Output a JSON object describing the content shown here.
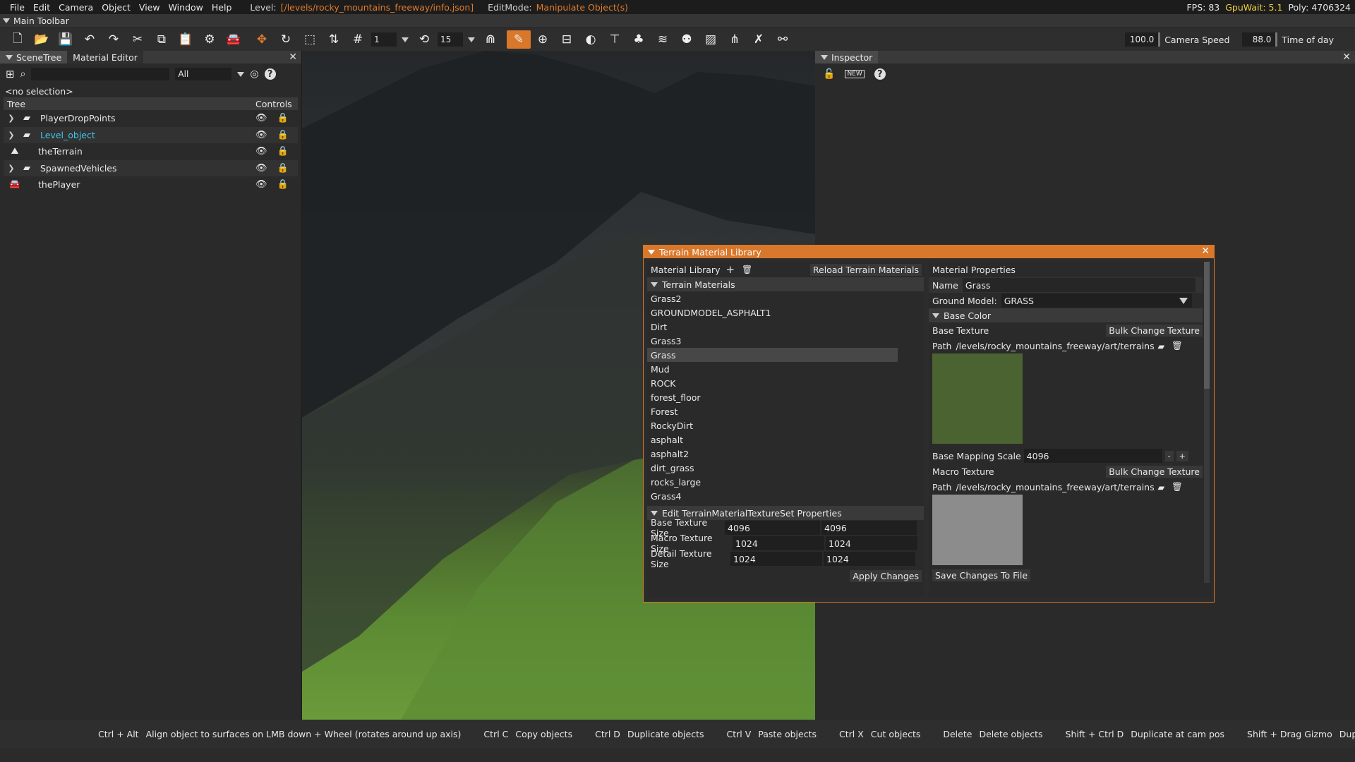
{
  "menu": {
    "items": [
      "File",
      "Edit",
      "Camera",
      "Object",
      "View",
      "Window",
      "Help"
    ],
    "level_label": "Level:",
    "level_path": "[/levels/rocky_mountains_freeway/info.json]",
    "editmode_label": "EditMode:",
    "editmode_value": "Manipulate Object(s)",
    "fps": "FPS: 83",
    "gpuwait": "GpuWait: 5.1",
    "poly": "Poly: 4706324"
  },
  "toolbar": {
    "title": "Main Toolbar",
    "snap_value": "1",
    "rotate_snap": "15",
    "camera_speed_value": "100.0",
    "camera_speed_label": "Camera Speed",
    "time_value": "88.0",
    "time_label": "Time of day"
  },
  "scene": {
    "tabs": [
      "SceneTree",
      "Material Editor"
    ],
    "filter": "All",
    "selection": "<no selection>",
    "col_tree": "Tree",
    "col_controls": "Controls",
    "rows": [
      {
        "name": "PlayerDropPoints",
        "icon": "folder-icon",
        "expandable": true
      },
      {
        "name": "Level_object",
        "icon": "folder-icon",
        "expandable": true,
        "highlight": true
      },
      {
        "name": "theTerrain",
        "icon": "terrain-icon",
        "expandable": false
      },
      {
        "name": "SpawnedVehicles",
        "icon": "folder-icon",
        "expandable": true
      },
      {
        "name": "thePlayer",
        "icon": "vehicle-icon",
        "expandable": false
      }
    ]
  },
  "inspector": {
    "title": "Inspector"
  },
  "tml": {
    "title": "Terrain Material Library",
    "library_label": "Material Library",
    "reload_button": "Reload Terrain Materials",
    "materials_header": "Terrain Materials",
    "materials": [
      "Grass2",
      "GROUNDMODEL_ASPHALT1",
      "Dirt",
      "Grass3",
      "Grass",
      "Mud",
      "ROCK",
      "forest_floor",
      "Forest",
      "RockyDirt",
      "asphalt",
      "asphalt2",
      "dirt_grass",
      "rocks_large",
      "Grass4"
    ],
    "selected_material": "Grass",
    "texset_header": "Edit TerrainMaterialTextureSet Properties",
    "base_size_label": "Base Texture Size",
    "base_size_w": "4096",
    "base_size_h": "4096",
    "macro_size_label": "Macro Texture Size",
    "macro_size_w": "1024",
    "macro_size_h": "1024",
    "detail_size_label": "Detail Texture Size",
    "detail_size_w": "1024",
    "detail_size_h": "1024",
    "apply_button": "Apply Changes",
    "props_title": "Material Properties",
    "name_label": "Name",
    "name_value": "Grass",
    "ground_model_label": "Ground Model:",
    "ground_model_value": "GRASS",
    "base_color_header": "Base Color",
    "base_texture_label": "Base Texture",
    "bulk_change": "Bulk Change Texture",
    "path_label": "Path",
    "base_path": "/levels/rocky_mountains_freeway/art/terrains/gra:",
    "base_swatch_color": "#4b6330",
    "base_mapping_label": "Base Mapping Scale",
    "base_mapping_value": "4096",
    "minus": "-",
    "plus": "+",
    "macro_texture_label": "Macro Texture",
    "macro_path": "/levels/rocky_mountains_freeway/art/terrains/t_m",
    "macro_swatch_color": "#8c8c8c",
    "save_button": "Save Changes To File"
  },
  "status": [
    {
      "key": "Ctrl + Alt",
      "desc": "Align object to surfaces on LMB down + Wheel (rotates around up axis)"
    },
    {
      "key": "Ctrl C",
      "desc": "Copy objects"
    },
    {
      "key": "Ctrl D",
      "desc": "Duplicate objects"
    },
    {
      "key": "Ctrl V",
      "desc": "Paste objects"
    },
    {
      "key": "Ctrl X",
      "desc": "Cut objects"
    },
    {
      "key": "Delete",
      "desc": "Delete objects"
    },
    {
      "key": "Shift + Ctrl D",
      "desc": "Duplicate at cam pos"
    },
    {
      "key": "Shift + Drag Gizmo",
      "desc": "Duplicate objects"
    }
  ],
  "colors": {
    "accent": "#d9772a",
    "highlight_text": "#3fc7e8",
    "path_text": "#e07b2e"
  }
}
